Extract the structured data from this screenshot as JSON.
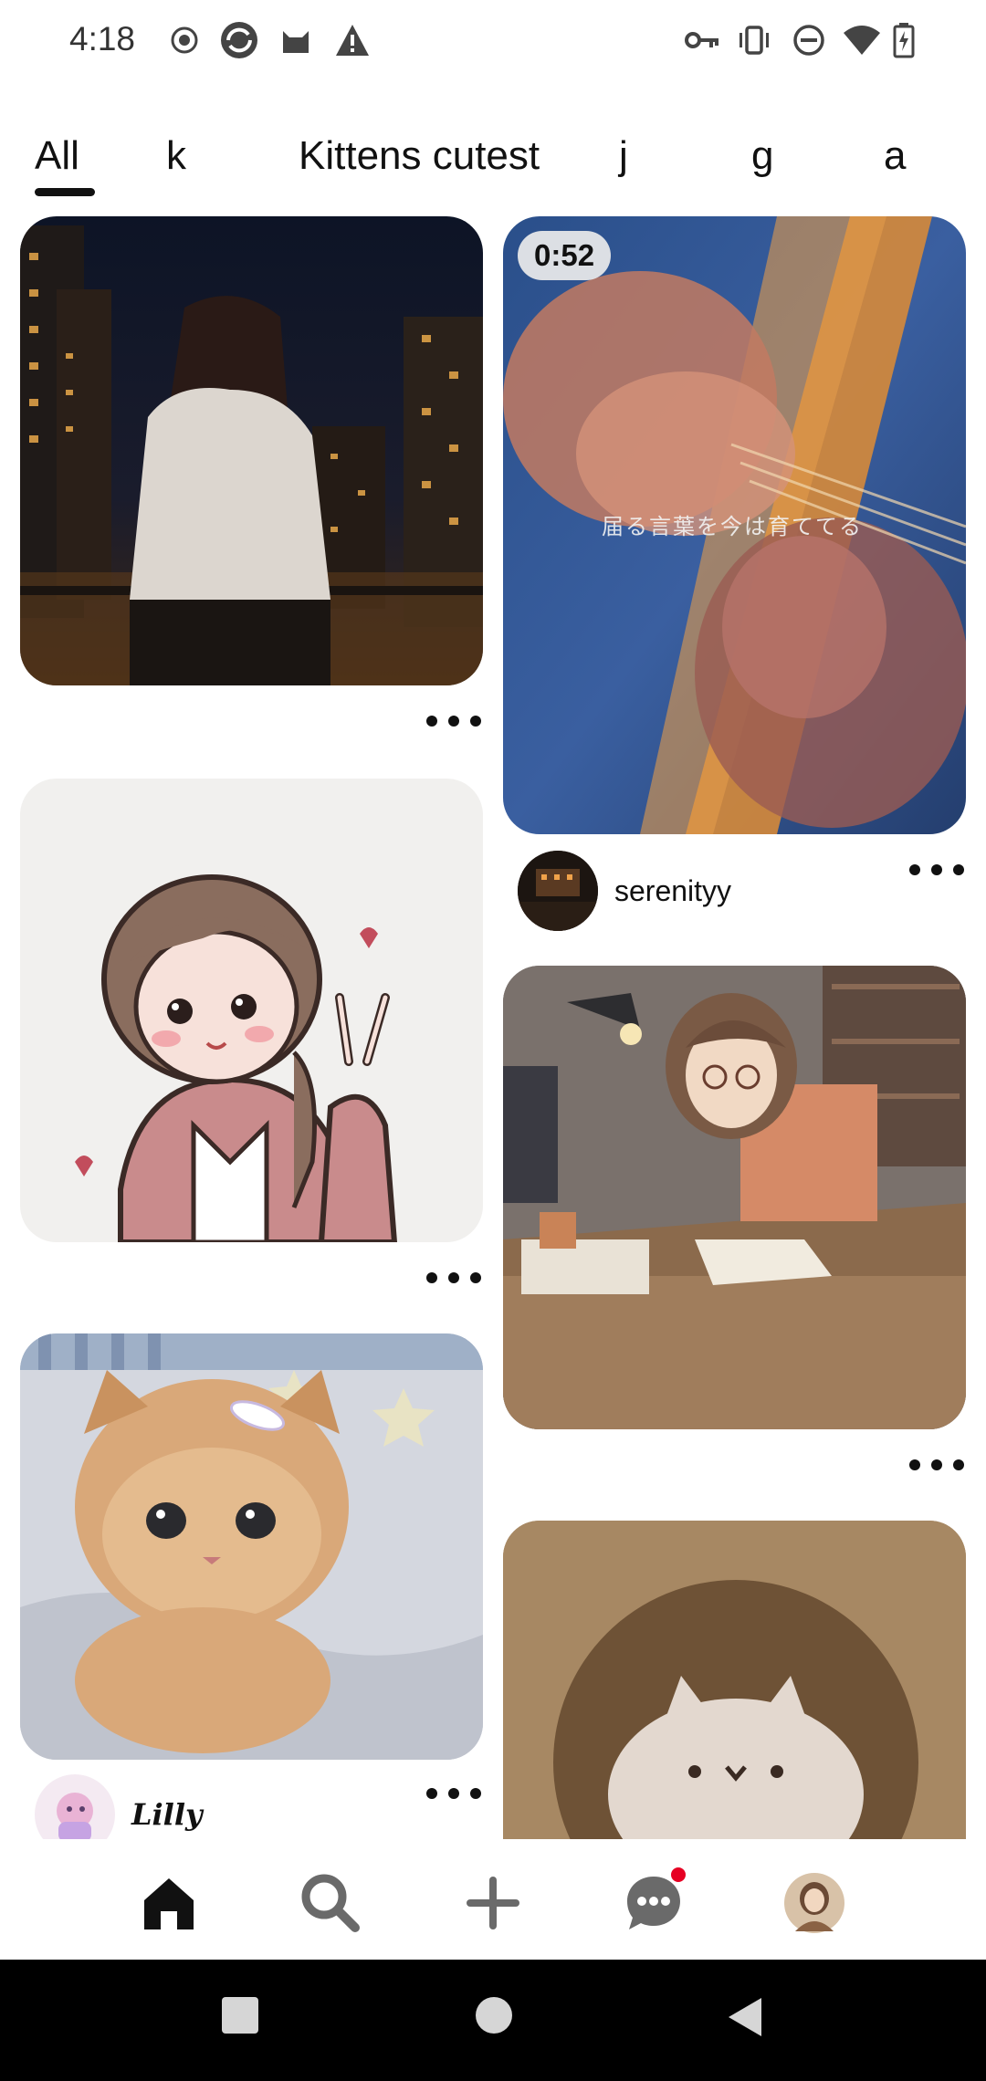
{
  "status_bar": {
    "time": "4:18",
    "left_icons": [
      "record-icon",
      "app-icon",
      "cat-icon",
      "warning-icon"
    ],
    "right_icons": [
      "key-icon",
      "vibrate-icon",
      "dnd-icon",
      "wifi-icon",
      "battery-icon"
    ]
  },
  "tabs": [
    {
      "label": "All",
      "selected": true
    },
    {
      "label": "k",
      "selected": false
    },
    {
      "label": "Kittens cutest",
      "selected": false
    },
    {
      "label": "j",
      "selected": false
    },
    {
      "label": "g",
      "selected": false
    },
    {
      "label": "a",
      "selected": false
    }
  ],
  "feed": {
    "video_pin": {
      "duration": "0:52",
      "overlay_text": "届る言葉を今は育ててる",
      "author": "serenityy"
    },
    "kitten_pin": {
      "author": "Lilly"
    }
  },
  "bottom_nav": {
    "items": [
      "home-icon",
      "search-icon",
      "create-icon",
      "messages-icon",
      "profile-avatar"
    ],
    "accent": "#e60023"
  }
}
